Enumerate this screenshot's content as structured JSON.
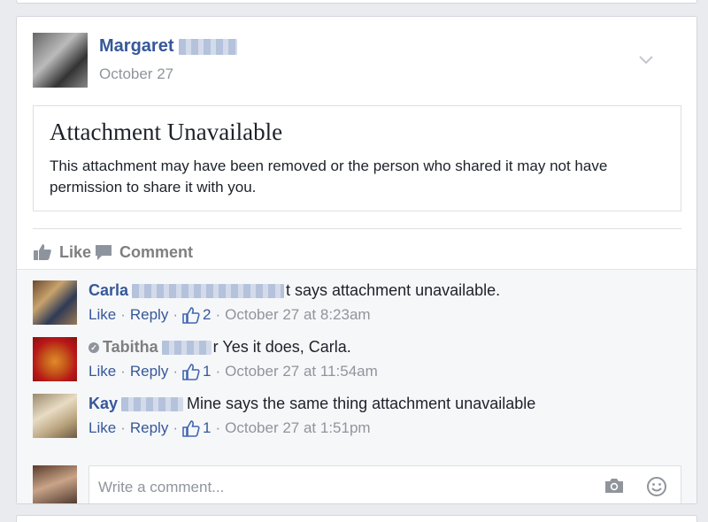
{
  "post": {
    "author": "Margaret",
    "date": "October 27",
    "attachment": {
      "title": "Attachment Unavailable",
      "body": "This attachment may have been removed or the person who shared it may not have permission to share it with you."
    },
    "actions": {
      "like": "Like",
      "comment": "Comment"
    }
  },
  "comments": [
    {
      "name": "Carla",
      "text": "t says attachment unavailable.",
      "like": "Like",
      "reply": "Reply",
      "likes": "2",
      "time": "October 27 at 8:23am"
    },
    {
      "name": "Tabitha",
      "text": "r Yes it does, Carla.",
      "like": "Like",
      "reply": "Reply",
      "likes": "1",
      "time": "October 27 at 11:54am"
    },
    {
      "name": "Kay",
      "text": "Mine says the same thing attachment unavailable",
      "like": "Like",
      "reply": "Reply",
      "likes": "1",
      "time": "October 27 at 1:51pm"
    }
  ],
  "composer": {
    "placeholder": "Write a comment..."
  },
  "separator": "·",
  "colors": {
    "link": "#365899",
    "meta": "#90949c",
    "background": "#e9ebee",
    "comments_bg": "#f6f7f9"
  },
  "icons": [
    "chevron-down-icon",
    "thumbs-up-icon",
    "comment-bubble-icon",
    "camera-icon",
    "smiley-icon",
    "verified-icon"
  ]
}
